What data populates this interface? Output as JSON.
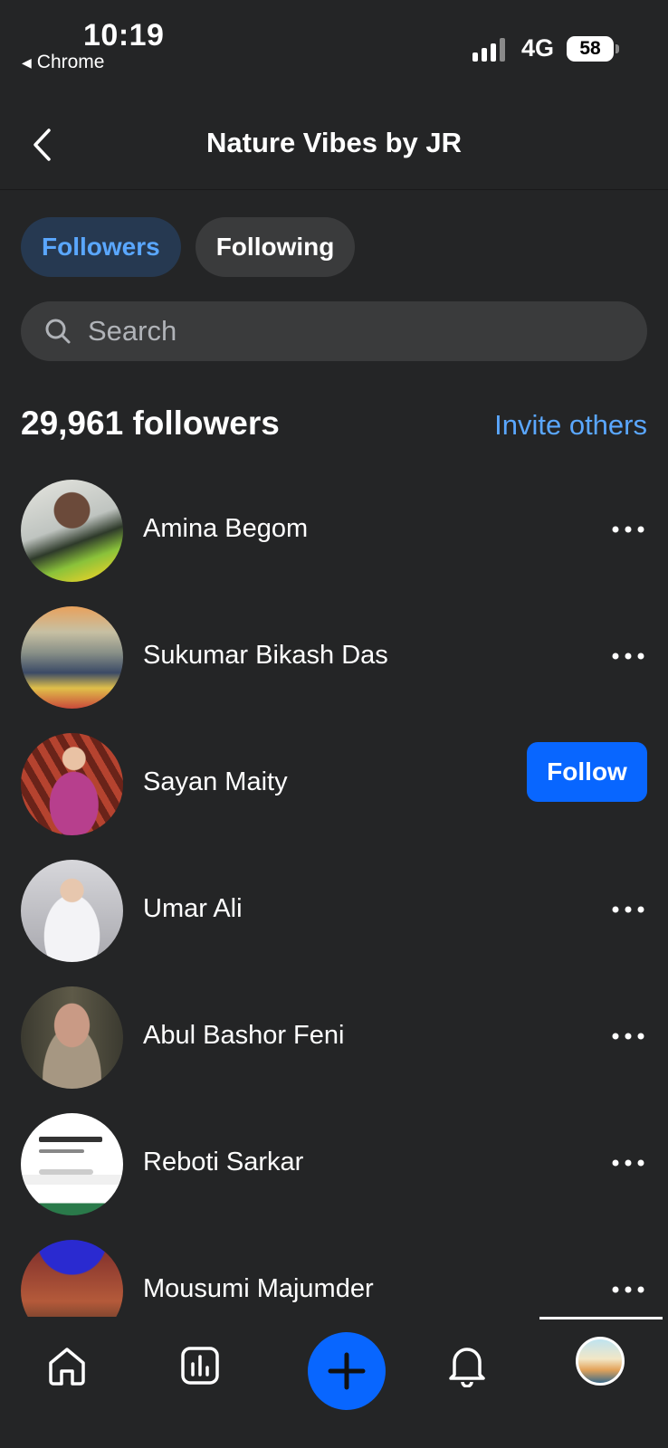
{
  "status_bar": {
    "time": "10:19",
    "back_app": "Chrome",
    "network": "4G",
    "battery": "58"
  },
  "header": {
    "title": "Nature Vibes by JR"
  },
  "tabs": [
    {
      "label": "Followers",
      "active": true
    },
    {
      "label": "Following",
      "active": false
    }
  ],
  "search": {
    "placeholder": "Search"
  },
  "followers": {
    "count_label": "29,961 followers",
    "invite_label": "Invite others"
  },
  "list": [
    {
      "name": "Amina Begom",
      "action": "more"
    },
    {
      "name": "Sukumar Bikash Das",
      "action": "more"
    },
    {
      "name": "Sayan Maity",
      "action": "follow",
      "follow_label": "Follow"
    },
    {
      "name": "Umar Ali",
      "action": "more"
    },
    {
      "name": "Abul Bashor Feni",
      "action": "more"
    },
    {
      "name": "Reboti Sarkar",
      "action": "more"
    },
    {
      "name": "Mousumi Majumder",
      "action": "more"
    }
  ],
  "nav": {
    "items": [
      "home-icon",
      "insights-icon",
      "create-icon",
      "notifications-icon",
      "profile-avatar"
    ]
  },
  "colors": {
    "background": "#242526",
    "accent": "#0866ff",
    "link": "#5aa7ff"
  }
}
